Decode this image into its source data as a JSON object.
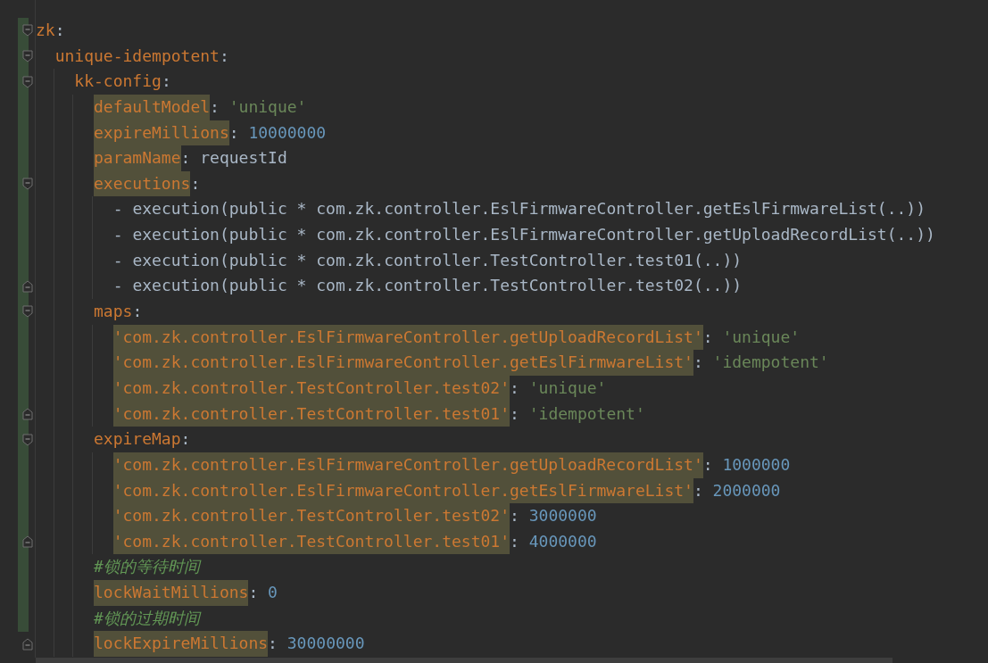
{
  "document": [
    {
      "kind": "mapping",
      "key": "zk",
      "colon": ":",
      "highlighted": false,
      "children": [
        {
          "kind": "mapping",
          "key": "unique-idempotent",
          "colon": ":",
          "highlighted": false,
          "children": [
            {
              "kind": "mapping",
              "key": "kk-config",
              "colon": ":",
              "highlighted": false,
              "children": [
                {
                  "kind": "pair",
                  "key": "defaultModel",
                  "colon": ":",
                  "highlighted": true,
                  "value": {
                    "kind": "string",
                    "text": "'unique'"
                  }
                },
                {
                  "kind": "pair",
                  "key": "expireMillions",
                  "colon": ":",
                  "highlighted": true,
                  "value": {
                    "kind": "number",
                    "text": "10000000"
                  }
                },
                {
                  "kind": "pair",
                  "key": "paramName",
                  "colon": ":",
                  "highlighted": true,
                  "value": {
                    "kind": "plain",
                    "text": "requestId"
                  }
                },
                {
                  "kind": "mapping",
                  "key": "executions",
                  "colon": ":",
                  "highlighted": true,
                  "children": [
                    {
                      "kind": "item",
                      "marker": "-",
                      "text": "execution(public * com.zk.controller.EslFirmwareController.getEslFirmwareList(..))"
                    },
                    {
                      "kind": "item",
                      "marker": "-",
                      "text": "execution(public * com.zk.controller.EslFirmwareController.getUploadRecordList(..))"
                    },
                    {
                      "kind": "item",
                      "marker": "-",
                      "text": "execution(public * com.zk.controller.TestController.test01(..))"
                    },
                    {
                      "kind": "item",
                      "marker": "-",
                      "text": "execution(public * com.zk.controller.TestController.test02(..))"
                    }
                  ]
                },
                {
                  "kind": "mapping",
                  "key": "maps",
                  "colon": ":",
                  "highlighted": false,
                  "children": [
                    {
                      "kind": "pair",
                      "key": "'com.zk.controller.EslFirmwareController.getUploadRecordList'",
                      "colon": ":",
                      "highlighted": true,
                      "value": {
                        "kind": "string",
                        "text": "'unique'"
                      }
                    },
                    {
                      "kind": "pair",
                      "key": "'com.zk.controller.EslFirmwareController.getEslFirmwareList'",
                      "colon": ":",
                      "highlighted": true,
                      "value": {
                        "kind": "string",
                        "text": "'idempotent'"
                      }
                    },
                    {
                      "kind": "pair",
                      "key": "'com.zk.controller.TestController.test02'",
                      "colon": ":",
                      "highlighted": true,
                      "value": {
                        "kind": "string",
                        "text": "'unique'"
                      }
                    },
                    {
                      "kind": "pair",
                      "key": "'com.zk.controller.TestController.test01'",
                      "colon": ":",
                      "highlighted": true,
                      "value": {
                        "kind": "string",
                        "text": "'idempotent'"
                      }
                    }
                  ]
                },
                {
                  "kind": "mapping",
                  "key": "expireMap",
                  "colon": ":",
                  "highlighted": false,
                  "children": [
                    {
                      "kind": "pair",
                      "key": "'com.zk.controller.EslFirmwareController.getUploadRecordList'",
                      "colon": ":",
                      "highlighted": true,
                      "value": {
                        "kind": "number",
                        "text": "1000000"
                      }
                    },
                    {
                      "kind": "pair",
                      "key": "'com.zk.controller.EslFirmwareController.getEslFirmwareList'",
                      "colon": ":",
                      "highlighted": true,
                      "value": {
                        "kind": "number",
                        "text": "2000000"
                      }
                    },
                    {
                      "kind": "pair",
                      "key": "'com.zk.controller.TestController.test02'",
                      "colon": ":",
                      "highlighted": true,
                      "value": {
                        "kind": "number",
                        "text": "3000000"
                      }
                    },
                    {
                      "kind": "pair",
                      "key": "'com.zk.controller.TestController.test01'",
                      "colon": ":",
                      "highlighted": true,
                      "value": {
                        "kind": "number",
                        "text": "4000000"
                      }
                    }
                  ]
                },
                {
                  "kind": "comment",
                  "text": "#锁的等待时间"
                },
                {
                  "kind": "pair",
                  "key": "lockWaitMillions",
                  "colon": ":",
                  "highlighted": true,
                  "value": {
                    "kind": "number",
                    "text": "0"
                  }
                },
                {
                  "kind": "comment",
                  "text": "#锁的过期时间"
                },
                {
                  "kind": "pair",
                  "key": "lockExpireMillions",
                  "colon": ":",
                  "highlighted": true,
                  "value": {
                    "kind": "number",
                    "text": "30000000"
                  }
                }
              ]
            }
          ]
        }
      ]
    }
  ]
}
